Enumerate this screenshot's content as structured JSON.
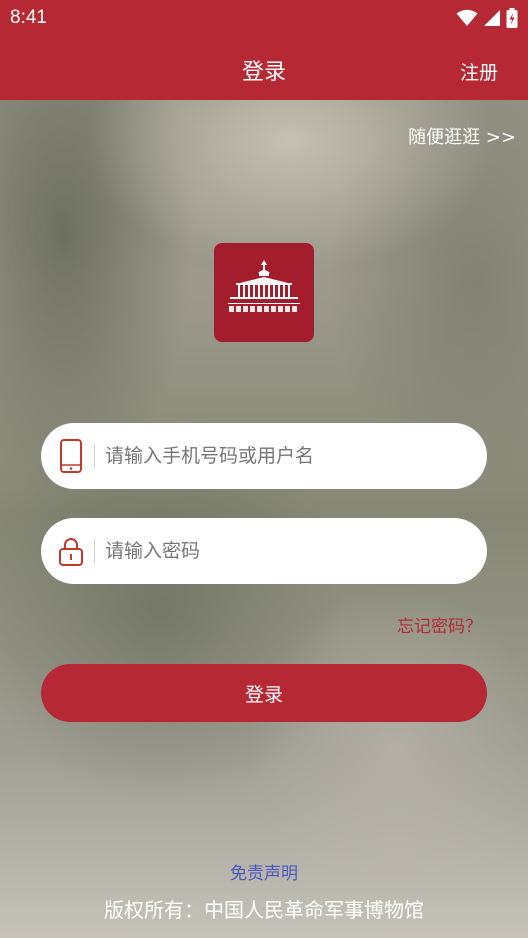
{
  "status_bar": {
    "time": "8:41"
  },
  "app_bar": {
    "title": "登录",
    "register_label": "注册"
  },
  "browse_label": "随便逛逛 >>",
  "logo": {
    "name": "中国人民革命军事博物馆"
  },
  "form": {
    "phone_placeholder": "请输入手机号码或用户名",
    "password_placeholder": "请输入密码",
    "forgot_label": "忘记密码？",
    "login_label": "登录"
  },
  "footer": {
    "disclaimer_label": "免责声明",
    "copyright": "版权所有：中国人民革命军事博物馆"
  },
  "colors": {
    "brand": "#b52834",
    "logo_bg": "#a41d2c",
    "link_blue": "#4a59c0"
  }
}
